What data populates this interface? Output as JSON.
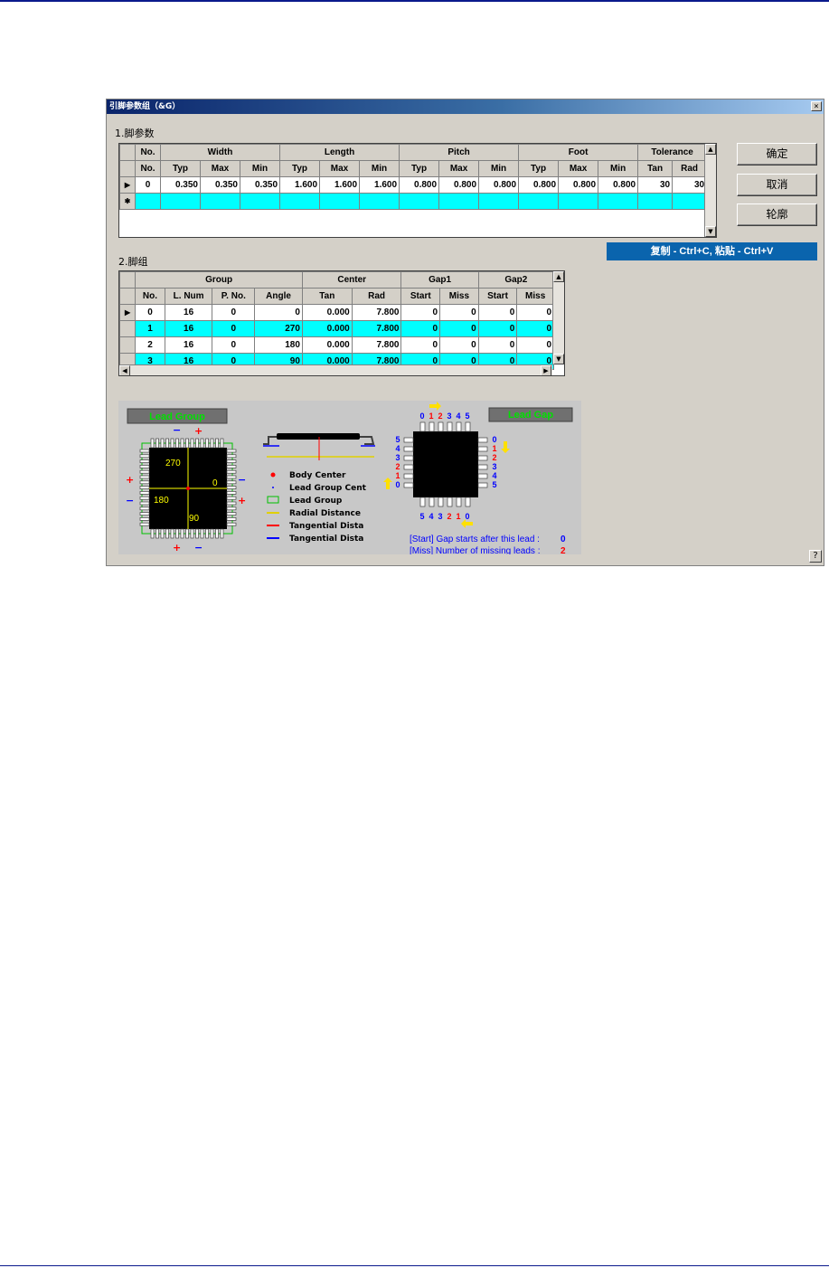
{
  "dialog": {
    "title": "引脚参数组（&G）",
    "close_label": "×",
    "help_label": "?"
  },
  "section1": {
    "label": "1.脚参数",
    "group_headers": [
      "No.",
      "Width",
      "Length",
      "Pitch",
      "Foot",
      "Tolerance"
    ],
    "sub_headers": [
      "No.",
      "Typ",
      "Max",
      "Min",
      "Typ",
      "Max",
      "Min",
      "Typ",
      "Max",
      "Min",
      "Typ",
      "Max",
      "Min",
      "Tan",
      "Rad"
    ],
    "row": {
      "indicator": "▶",
      "values": [
        "0",
        "0.350",
        "0.350",
        "0.350",
        "1.600",
        "1.600",
        "1.600",
        "0.800",
        "0.800",
        "0.800",
        "0.800",
        "0.800",
        "0.800",
        "30",
        "30"
      ]
    },
    "new_row_indicator": "✱"
  },
  "buttons": {
    "ok": "确定",
    "cancel": "取消",
    "outline": "轮廓"
  },
  "hint": "复制 - Ctrl+C, 粘贴 - Ctrl+V",
  "section2": {
    "label": "2.脚组",
    "group_headers": [
      "Group",
      "Center",
      "Gap1",
      "Gap2"
    ],
    "sub_headers": [
      "No.",
      "L. Num",
      "P. No.",
      "Angle",
      "Tan",
      "Rad",
      "Start",
      "Miss",
      "Start",
      "Miss"
    ],
    "rows": [
      {
        "indicator": "▶",
        "values": [
          "0",
          "16",
          "0",
          "0",
          "0.000",
          "7.800",
          "0",
          "0",
          "0",
          "0"
        ]
      },
      {
        "indicator": "",
        "values": [
          "1",
          "16",
          "0",
          "270",
          "0.000",
          "7.800",
          "0",
          "0",
          "0",
          "0"
        ]
      },
      {
        "indicator": "",
        "values": [
          "2",
          "16",
          "0",
          "180",
          "0.000",
          "7.800",
          "0",
          "0",
          "0",
          "0"
        ]
      },
      {
        "indicator": "",
        "values": [
          "3",
          "16",
          "0",
          "90",
          "0.000",
          "7.800",
          "0",
          "0",
          "0",
          "0"
        ]
      }
    ]
  },
  "diagram": {
    "lead_group_title": "Lead Group",
    "lead_gap_title": "Lead Gap",
    "angles": [
      "270",
      "0",
      "180",
      "90"
    ],
    "legend": [
      "Body Center",
      "Lead Group Cent",
      "Lead Group",
      "Radial Distance",
      "Tangential Dista",
      "Tangential Dista"
    ],
    "top_numbers": [
      "0",
      "1",
      "2",
      "3",
      "4",
      "5"
    ],
    "bottom_numbers": [
      "5",
      "4",
      "3",
      "2",
      "1",
      "0"
    ],
    "left_numbers": [
      "5",
      "4",
      "3",
      "2",
      "1",
      "0"
    ],
    "right_numbers": [
      "0",
      "1",
      "2",
      "3",
      "4",
      "5"
    ],
    "gap_note_start": "[Start] Gap starts after this lead :",
    "gap_note_start_value": "0",
    "gap_note_miss": "[Miss] Number of missing leads :",
    "gap_note_miss_value": "2",
    "colors": {
      "green_text": "#00e000",
      "red": "#ff0000",
      "blue": "#0000ff",
      "yellow": "#ffff00"
    }
  }
}
